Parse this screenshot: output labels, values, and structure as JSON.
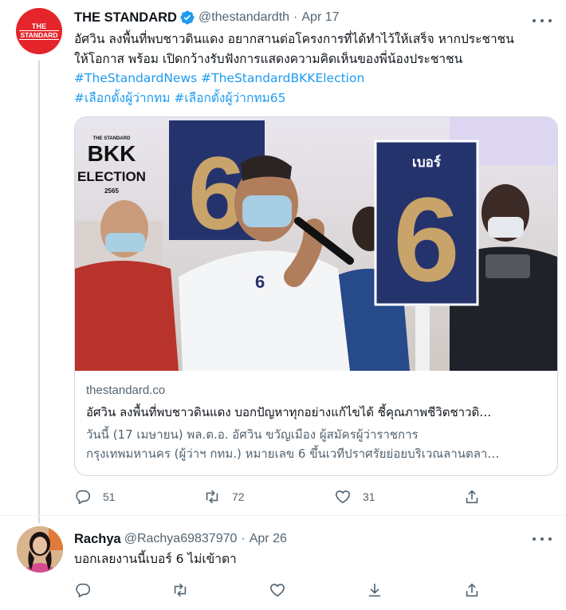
{
  "tweet1": {
    "avatar": {
      "line1": "THE",
      "line2": "STANDARD"
    },
    "name": "THE STANDARD",
    "handle": "@thestandardth",
    "separator": "·",
    "date": "Apr 17",
    "text_lines": [
      "อัศวิน ลงพื้นที่พบชาวดินแดง อยากสานต่อโครงการที่ได้ทำไว้ให้เสร็จ หากประชาชน",
      "ให้โอกาส พร้อม เปิดกว้างรับฟังการแสดงความคิดเห็นของพี่น้องประชาชน"
    ],
    "hashtags_line1": [
      "#TheStandardNews",
      "#TheStandardBKKElection"
    ],
    "hashtags_line2": [
      "#เลือกตั้งผู้ว่ากทม",
      "#เลือกตั้งผู้ว่ากทม65"
    ],
    "card": {
      "image_badge": {
        "top": "THE STANDARD",
        "l1": "BKK",
        "l2": "ELECTION",
        "year": "2565"
      },
      "sign_label": "เบอร์",
      "sign_number": "6",
      "domain": "thestandard.co",
      "title": "อัศวิน ลงพื้นที่พบชาวดินแดง บอกปัญหาทุกอย่างแก้ไขได้ ชี้คุณภาพชีวิตชาวดิ…",
      "desc_line1": "วันนี้ (17 เมษายน) พล.ต.อ. อัศวิน ขวัญเมือง ผู้สมัครผู้ว่าราชการ",
      "desc_line2": "กรุงเทพมหานคร (ผู้ว่าฯ กทม.) หมายเลข 6 ขึ้นเวทีปราศรัยย่อยบริเวณลานตลา…"
    },
    "actions": {
      "replies": "51",
      "retweets": "72",
      "likes": "31"
    }
  },
  "tweet2": {
    "name": "Rachya",
    "handle": "@Rachya69837970",
    "separator": "·",
    "date": "Apr 26",
    "text": "บอกเลยงานนี้เบอร์ 6 ไม่เข้าตา"
  },
  "colors": {
    "link": "#1d9bf0",
    "muted": "#536471",
    "brand_red": "#e4252b"
  }
}
